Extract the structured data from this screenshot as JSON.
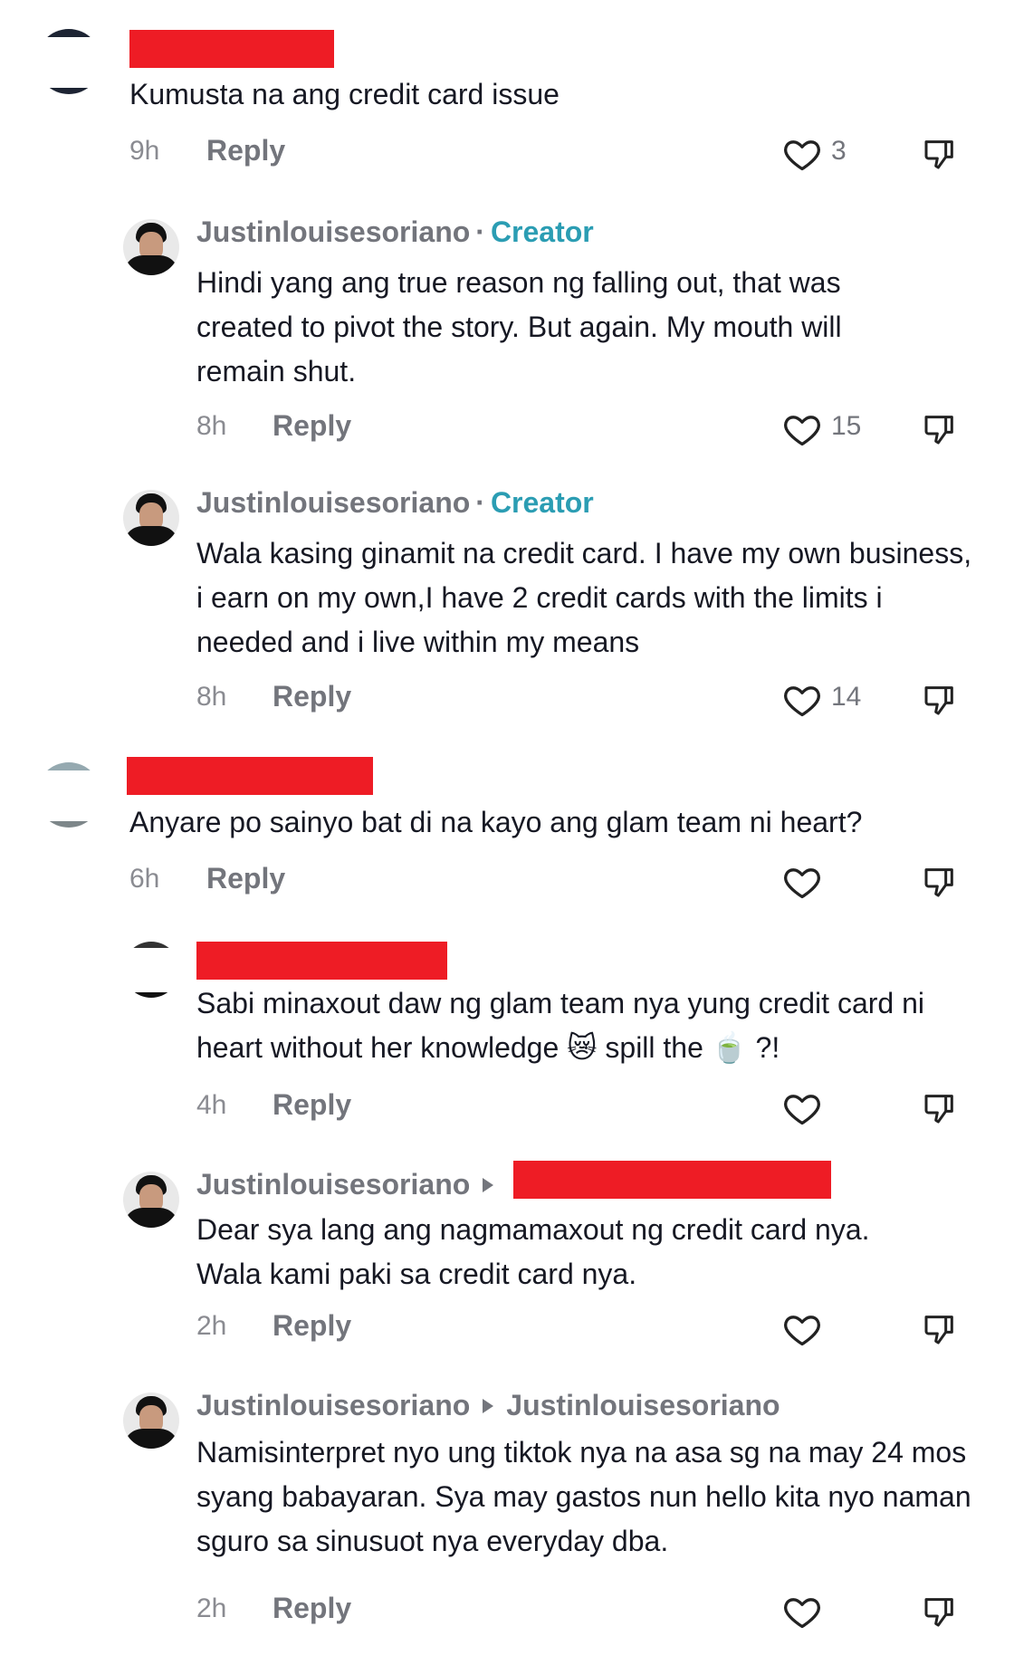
{
  "comments": [
    {
      "time": "9h",
      "reply": "Reply",
      "text": "Kumusta na ang credit card issue",
      "likes": "3"
    },
    {
      "username": "Justinlouisesoriano",
      "tag": "Creator",
      "separator": "·",
      "text": "Hindi yang ang true reason ng falling out, that was created to pivot the story. But again. My mouth will remain shut.",
      "time": "8h",
      "reply": "Reply",
      "likes": "15"
    },
    {
      "username": "Justinlouisesoriano",
      "tag": "Creator",
      "separator": "·",
      "text": "Wala kasing ginamit na credit card. I have my own business, i earn on my own,I have 2 credit cards with the limits i needed and i live within my means",
      "time": "8h",
      "reply": "Reply",
      "likes": "14"
    },
    {
      "text": "Anyare po sainyo bat di na kayo ang glam team ni heart?",
      "time": "6h",
      "reply": "Reply",
      "likes": ""
    },
    {
      "text": "Sabi minaxout daw ng glam team nya yung credit card ni heart without her knowledge 😿 spill the 🍵 ?!",
      "time": "4h",
      "reply": "Reply",
      "likes": ""
    },
    {
      "username": "Justinlouisesoriano",
      "text": "Dear sya lang ang nagmamaxout ng credit card nya. Wala kami paki sa credit card nya.",
      "time": "2h",
      "reply": "Reply",
      "likes": ""
    },
    {
      "username": "Justinlouisesoriano",
      "reply_to": "Justinlouisesoriano",
      "text": "Namisinterpret nyo ung tiktok nya na asa sg na may 24 mos syang babayaran. Sya may gastos nun hello kita nyo naman sguro sa sinusuot nya everyday dba.",
      "time": "2h",
      "reply": "Reply",
      "likes": ""
    }
  ],
  "colors": {
    "redaction": "#ee1c25",
    "creator_tag": "#2b9db3",
    "muted": "#73757c"
  },
  "icons": {
    "like": "heart-icon",
    "dislike": "thumbs-down-icon",
    "reply_arrow": "reply-arrow-icon"
  }
}
